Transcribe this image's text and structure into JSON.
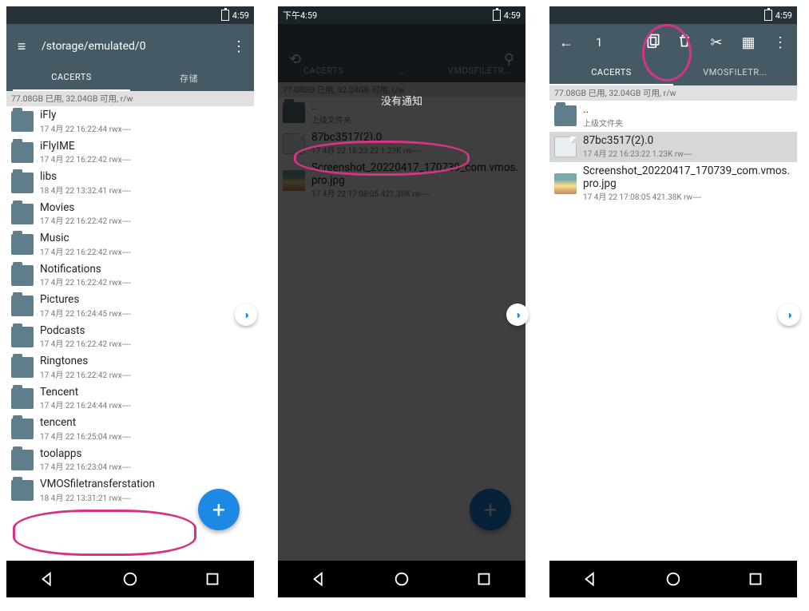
{
  "time": "4:59",
  "time2_prefix": "下午4:59",
  "phone1": {
    "path": "/storage/emulated/0",
    "tabs": [
      "CACERTS",
      "存储"
    ],
    "active_tab": 0,
    "storage_line": "77.08GB 已用, 32.04GB 可用, r/w",
    "items": [
      {
        "name": "iFly",
        "sub": "17 4月 22 16:22:44  rwx----"
      },
      {
        "name": "iFlyIME",
        "sub": "17 4月 22 16:22:42  rwx----"
      },
      {
        "name": "libs",
        "sub": "18 4月 22 13:32:41  rwx----"
      },
      {
        "name": "Movies",
        "sub": "17 4月 22 16:22:42  rwx----"
      },
      {
        "name": "Music",
        "sub": "17 4月 22 16:22:42  rwx----"
      },
      {
        "name": "Notifications",
        "sub": "17 4月 22 16:22:42  rwx----"
      },
      {
        "name": "Pictures",
        "sub": "17 4月 22 16:24:45  rwx----"
      },
      {
        "name": "Podcasts",
        "sub": "17 4月 22 16:22:42  rwx----"
      },
      {
        "name": "Ringtones",
        "sub": "17 4月 22 16:22:42  rwx----"
      },
      {
        "name": "Tencent",
        "sub": "17 4月 22 16:24:44  rwx----"
      },
      {
        "name": "tencent",
        "sub": "17 4月 22 16:25:04  rwx----"
      },
      {
        "name": "toolapps",
        "sub": "17 4月 22 16:23:04  rwx----"
      },
      {
        "name": "VMOSfiletransferstation",
        "sub": "18 4月 22 13:31:21  rwx----"
      }
    ]
  },
  "phone2": {
    "tabs": [
      "CACERTS",
      "...",
      "VMOSFILETR..."
    ],
    "storage_line": "77.08GB 已用, 32.04GB 可用, r/w",
    "no_notif": "没有通知",
    "parent_label": "..",
    "parent_sub": "上级文件夹",
    "items": [
      {
        "name": "87bc3517(2).0",
        "sub": "17 4月 22 16:23:22  1.23K  rw----",
        "kind": "file"
      },
      {
        "name": "Screenshot_20220417_170739_com.vmos.pro.jpg",
        "sub": "17 4月 22 17:08:05  421.38K  rw----",
        "kind": "img"
      }
    ]
  },
  "phone3": {
    "selection_count": "1",
    "tabs": [
      "CACERTS",
      "VMOSFILETR..."
    ],
    "active_tab": 0,
    "storage_line": "77.08GB 已用, 32.04GB 可用, r/w",
    "parent_label": "..",
    "parent_sub": "上级文件夹",
    "items": [
      {
        "name": "87bc3517(2).0",
        "sub": "17 4月 22 16:23:22  1.23K  rw----",
        "kind": "file",
        "selected": true
      },
      {
        "name": "Screenshot_20220417_170739_com.vmos.pro.jpg",
        "sub": "17 4月 22 17:08:05  421.38K  rw----",
        "kind": "img"
      }
    ]
  }
}
